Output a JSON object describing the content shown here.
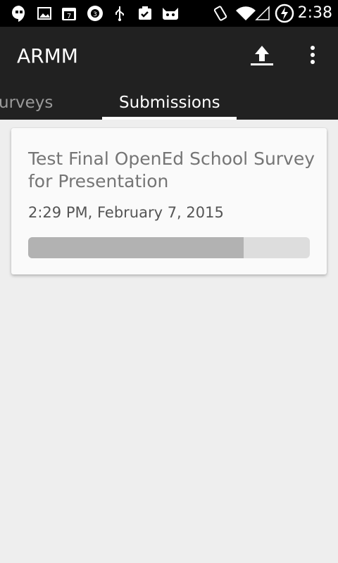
{
  "status_bar": {
    "time": "2:38",
    "icons": [
      "hangouts-icon",
      "image-icon",
      "calendar-icon",
      "settings-badge-icon",
      "usb-icon",
      "clipboard-check-icon",
      "cat-face-icon",
      "vibrate-icon",
      "wifi-icon",
      "no-signal-icon",
      "battery-charging-icon"
    ]
  },
  "action_bar": {
    "title": "ARMM",
    "upload_icon": "upload-icon",
    "overflow_icon": "more-vert-icon"
  },
  "tabs": [
    {
      "label": "Surveys",
      "visible_text": "urveys",
      "active": false
    },
    {
      "label": "Submissions",
      "active": true
    }
  ],
  "submissions": [
    {
      "title": "Test Final OpenEd School Survey for Presentation",
      "date": "2:29 PM, February 7, 2015",
      "progress": 0.765
    }
  ],
  "colors": {
    "action_bar": "#212121",
    "status_bar": "#000000",
    "background": "#eeeeee",
    "card": "#fafafa",
    "progress_fill": "#b2b2b2",
    "progress_track": "#dddddd"
  }
}
